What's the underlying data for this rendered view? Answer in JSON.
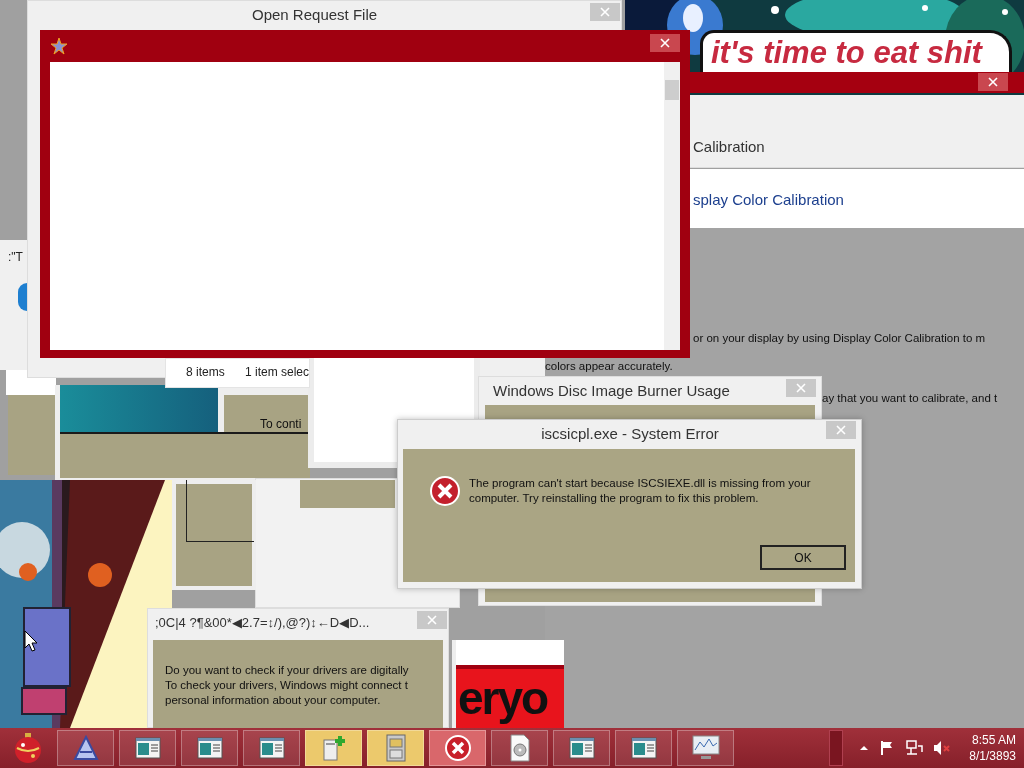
{
  "wallpaper_banner": {
    "text": "it's time to eat shit"
  },
  "calibration_window": {
    "heading": "Calibration",
    "link": "splay Color Calibration",
    "lines": [
      "or on your display by using Display Color Calibration to m",
      "colors appear accurately.",
      "ay that you want to calibrate, and t"
    ]
  },
  "open_request_file": {
    "title": "Open Request File"
  },
  "fragments": [
    ":\"T",
    "To conti"
  ],
  "explorer_status": [
    "8 items",
    "1 item selec"
  ],
  "disc_burner": {
    "title": "Windows Disc Image Burner Usage"
  },
  "error_dialog": {
    "title": "iscsicpl.exe - System Error",
    "message": "The program can't start because ISCSIEXE.dll is missing from your computer. Try reinstalling the program to fix this problem.",
    "button": "OK"
  },
  "driver_dialog": {
    "title": ";0C|4  ?¶&00*◀2.7=↕/),@?)↕←D◀D...",
    "lines": [
      "Do you want to check if your drivers are digitally",
      "To check your drivers, Windows might connect t",
      "personal information about your computer."
    ]
  },
  "red_banner": {
    "text": "eryo"
  },
  "taskbar": {
    "buttons": [
      {
        "kind": "triangle",
        "selected": false,
        "flashing": false
      },
      {
        "kind": "window",
        "selected": false,
        "flashing": false
      },
      {
        "kind": "window",
        "selected": false,
        "flashing": false
      },
      {
        "kind": "window",
        "selected": false,
        "flashing": false
      },
      {
        "kind": "server",
        "selected": false,
        "flashing": true
      },
      {
        "kind": "cabinet",
        "selected": false,
        "flashing": true
      },
      {
        "kind": "error",
        "selected": true,
        "flashing": false
      },
      {
        "kind": "disc",
        "selected": false,
        "flashing": false
      },
      {
        "kind": "window",
        "selected": false,
        "flashing": false
      },
      {
        "kind": "window",
        "selected": false,
        "flashing": false
      },
      {
        "kind": "monitor",
        "selected": false,
        "flashing": false
      }
    ],
    "clock": {
      "time": "8:55 AM",
      "date": "8/1/3893"
    }
  }
}
